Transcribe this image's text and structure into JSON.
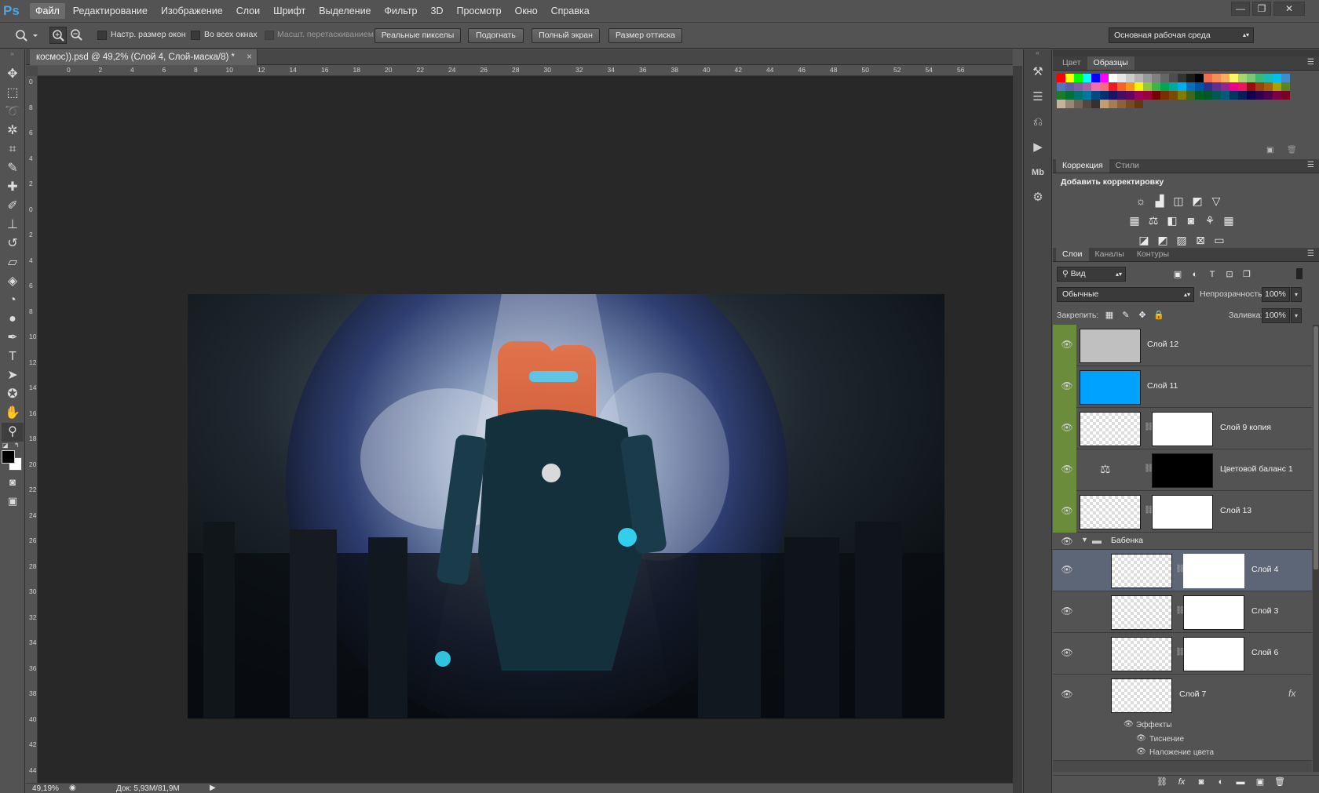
{
  "app": {
    "logo": "Ps"
  },
  "menu": [
    "Файл",
    "Редактирование",
    "Изображение",
    "Слои",
    "Шрифт",
    "Выделение",
    "Фильтр",
    "3D",
    "Просмотр",
    "Окно",
    "Справка"
  ],
  "window_controls": {
    "minimize": "—",
    "restore": "❐",
    "close": "✕"
  },
  "options": {
    "resize_windows": "Настр. размер окон",
    "all_windows": "Во всех окнах",
    "scrubby_zoom": "Масшт. перетаскиванием",
    "actual_pixels": "Реальные пикселы",
    "fit": "Подогнать",
    "fullscreen": "Полный экран",
    "print_size": "Размер оттиска",
    "workspace": "Основная рабочая среда"
  },
  "document": {
    "tab_title": "космос)).psd @ 49,2% (Слой 4, Слой-маска/8) *",
    "close": "×"
  },
  "rulers": {
    "h": [
      "0",
      "2",
      "4",
      "6",
      "8",
      "10",
      "12",
      "14",
      "16",
      "18",
      "20",
      "22",
      "24",
      "26",
      "28",
      "30",
      "32",
      "34",
      "36",
      "38",
      "40",
      "42",
      "44",
      "46",
      "48",
      "50",
      "52",
      "54",
      "56"
    ],
    "v": [
      "0",
      "8",
      "6",
      "4",
      "2",
      "0",
      "2",
      "4",
      "6",
      "8",
      "10",
      "12",
      "14",
      "16",
      "18",
      "20",
      "22",
      "24",
      "26",
      "28",
      "30",
      "32",
      "34",
      "36",
      "38",
      "40",
      "42",
      "44"
    ]
  },
  "status": {
    "zoom": "49,19%",
    "doc": "Док: 5,93M/81,9M"
  },
  "panels": {
    "color_tabs": [
      "Цвет",
      "Образцы"
    ],
    "adjust_tabs": [
      "Коррекция",
      "Стили"
    ],
    "adjust_title": "Добавить корректировку",
    "layers_tabs": [
      "Слои",
      "Каналы",
      "Контуры"
    ],
    "filter_kind": "Вид",
    "blend_mode": "Обычные",
    "opacity_label": "Непрозрачность:",
    "opacity_value": "100%",
    "lock_label": "Закрепить:",
    "fill_label": "Заливка:",
    "fill_value": "100%"
  },
  "layers": [
    {
      "name": "Слой 12"
    },
    {
      "name": "Слой 11"
    },
    {
      "name": "Слой 9 копия"
    },
    {
      "name": "Цветовой баланс 1"
    },
    {
      "name": "Слой 13"
    },
    {
      "name": "Бабенка"
    },
    {
      "name": "Слой 4"
    },
    {
      "name": "Слой 3"
    },
    {
      "name": "Слой 6"
    },
    {
      "name": "Слой 7"
    }
  ],
  "effects": {
    "title": "Эффекты",
    "items": [
      "Тиснение",
      "Наложение цвета"
    ]
  },
  "colors": {
    "accent": "#4fa3e0",
    "selected_layer": "#5d6677",
    "eye_green": "#6a8c3b",
    "blue_layer": "#00a2ff",
    "gray_layer": "#c0c0c0"
  }
}
